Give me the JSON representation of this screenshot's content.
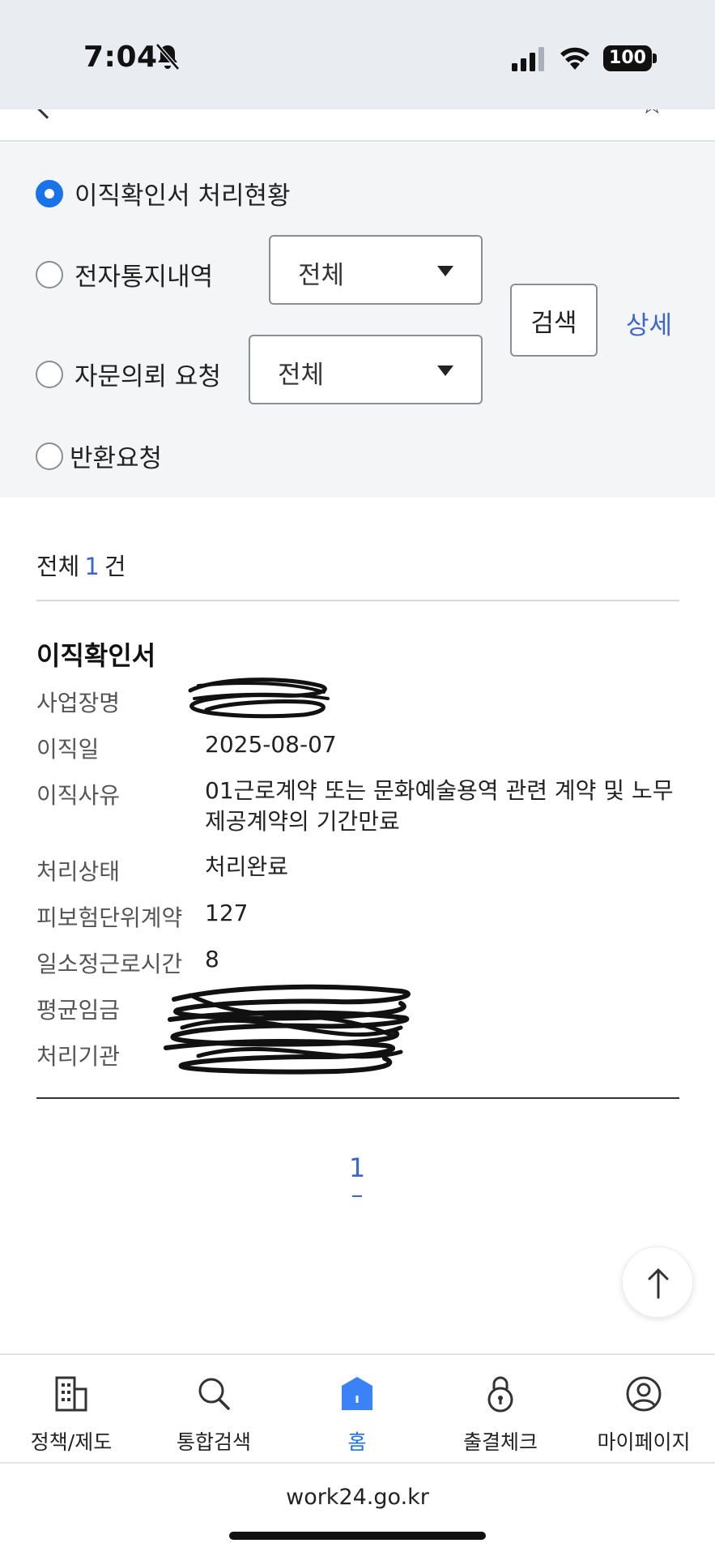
{
  "status_bar": {
    "time": "7:04",
    "battery": "100"
  },
  "filters": {
    "options": [
      {
        "label": "이직확인서 처리현황",
        "checked": true
      },
      {
        "label": "전자통지내역",
        "checked": false,
        "select": "전체"
      },
      {
        "label": "자문의뢰 요청",
        "checked": false,
        "select": "전체"
      },
      {
        "label": "반환요청",
        "checked": false
      }
    ],
    "search_label": "검색",
    "detail_label": "상세"
  },
  "results": {
    "total_prefix": "전체",
    "total_count": "1",
    "total_suffix": "건"
  },
  "card": {
    "title": "이직확인서",
    "fields": [
      {
        "label": "사업장명",
        "value": ""
      },
      {
        "label": "이직일",
        "value": "2025-08-07"
      },
      {
        "label": "이직사유",
        "value": "01근로계약 또는 문화예술용역 관련 계약 및 노무제공계약의 기간만료"
      },
      {
        "label": "처리상태",
        "value": "처리완료"
      },
      {
        "label": "피보험단위계약",
        "value": "127"
      },
      {
        "label": "일소정근로시간",
        "value": "8"
      },
      {
        "label": "평균임금",
        "value": ""
      },
      {
        "label": "처리기관",
        "value": ""
      }
    ]
  },
  "pagination": {
    "current": "1"
  },
  "tab_bar": {
    "tabs": [
      {
        "label": "정책/제도",
        "icon": "building-icon"
      },
      {
        "label": "통합검색",
        "icon": "search-icon"
      },
      {
        "label": "홈",
        "icon": "home-icon",
        "active": true
      },
      {
        "label": "출결체크",
        "icon": "lock-icon"
      },
      {
        "label": "마이페이지",
        "icon": "user-icon"
      }
    ]
  },
  "browser": {
    "url": "work24.go.kr"
  },
  "colors": {
    "accent": "#1a73e8",
    "link": "#3b67c8",
    "panel_bg": "#f4f5f7",
    "status_bg": "#e9edf2"
  }
}
